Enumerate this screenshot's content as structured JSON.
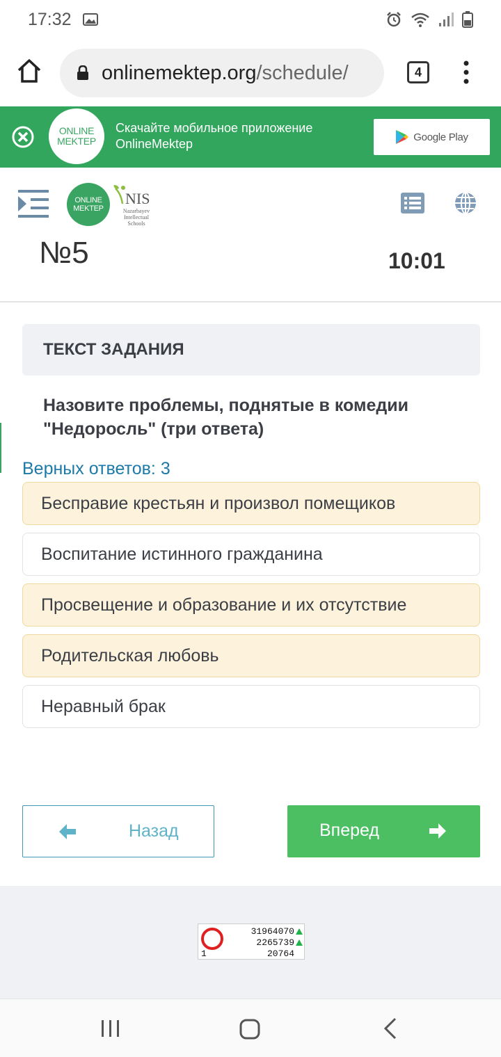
{
  "status_bar": {
    "time": "17:32"
  },
  "browser": {
    "url_host": "onlinemektep.org",
    "url_path": "/schedule/",
    "tab_count": "4"
  },
  "banner": {
    "logo_line1": "ONLINE",
    "logo_line2": "MEKTEP",
    "text_line1": "Скачайте мобильное приложение",
    "text_line2": "OnlineMektep",
    "store_button": "Google Play"
  },
  "header": {
    "logo_line1": "ONLINE",
    "logo_line2": "MEKTEP",
    "nis_name": "NIS",
    "nis_sub_line1": "Nazarbayev",
    "nis_sub_line2": "Intellectual",
    "nis_sub_line3": "Schools",
    "task_number": "№5",
    "timer": "10:01"
  },
  "task": {
    "header_label": "ТЕКСТ ЗАДАНИЯ",
    "question": "Назовите проблемы, поднятые в комедии \"Недоросль\" (три ответа)",
    "correct_count": "Верных ответов: 3",
    "answers": [
      {
        "text": "Бесправие крестьян и произвол помещиков",
        "selected": true
      },
      {
        "text": "Воспитание истинного гражданина",
        "selected": false
      },
      {
        "text": "Просвещение и образование и их отсутствие",
        "selected": true
      },
      {
        "text": "Родительская любовь",
        "selected": true
      },
      {
        "text": "Неравный брак",
        "selected": false
      }
    ]
  },
  "navigation": {
    "back_label": "Назад",
    "next_label": "Вперед"
  },
  "counter": {
    "value1": "31964070",
    "value2": "2265739",
    "value3": "20764",
    "left_value": "1"
  },
  "colors": {
    "brand_green": "#33a65e",
    "button_green": "#4cbf63",
    "selected_bg": "#fdf3dd",
    "link_blue": "#1d7aa8"
  }
}
